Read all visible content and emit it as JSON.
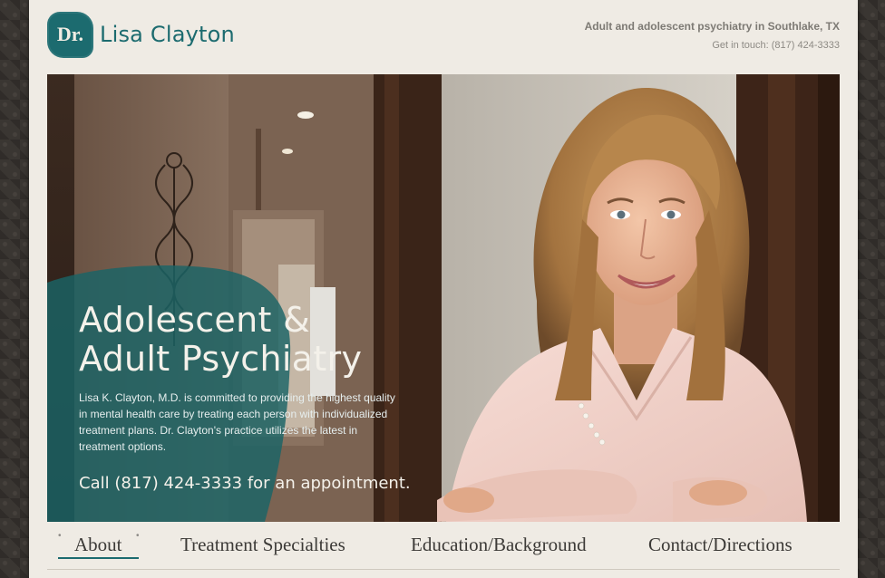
{
  "header": {
    "logo_badge": "Dr.",
    "logo_name": "Lisa Clayton",
    "tagline": "Adult and adolescent psychiatry in Southlake, TX",
    "contact": "Get in touch: (817) 424-3333"
  },
  "hero": {
    "title_line1": "Adolescent &",
    "title_line2": "Adult Psychiatry",
    "body": "Lisa K. Clayton, M.D. is committed to providing the highest quality in mental health care by treating each person with individualized treatment plans. Dr. Clayton's practice utilizes the latest in treatment options.",
    "cta": "Call (817) 424-3333 for an appointment."
  },
  "nav": {
    "items": [
      {
        "label": "About",
        "active": true
      },
      {
        "label": "Treatment Specialties",
        "active": false
      },
      {
        "label": "Education/Background",
        "active": false
      },
      {
        "label": "Contact/Directions",
        "active": false
      }
    ]
  },
  "colors": {
    "brand_teal": "#1c6b6f",
    "page_bg": "#efebe4",
    "outer_bg": "#3a3632"
  }
}
